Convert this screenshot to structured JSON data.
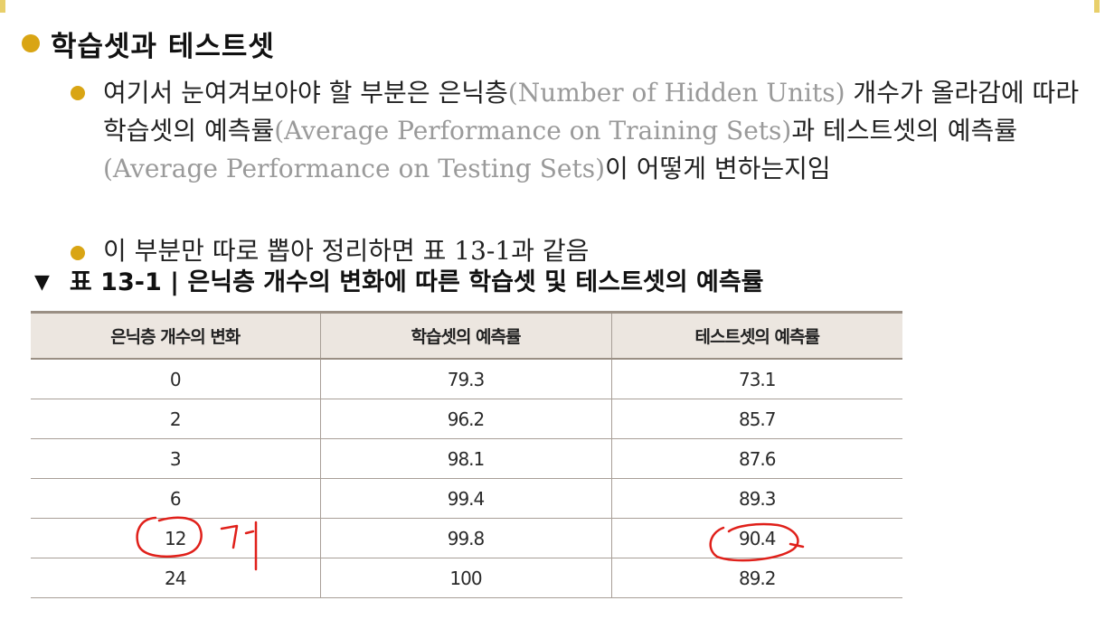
{
  "heading": "학습셋과 테스트셋",
  "paragraph1": {
    "part1": "여기서 눈여겨보아야 할 부분은 은닉층",
    "eng1": "(Number of Hidden Units)",
    "part2": " 개수가 올라감에 따라 학습셋의 예측률",
    "eng2": "(Average Performance on Training Sets)",
    "part3": "과 테스트셋의 예측률",
    "eng3": "(Average Performance on Testing Sets)",
    "part4": "이 어떻게 변하는지임"
  },
  "paragraph2": "이 부분만 따로 뽑아 정리하면 표 13-1과 같음",
  "table": {
    "caption": "표 13-1 | 은닉층 개수의 변화에 따른 학습셋 및 테스트셋의 예측률",
    "headers": [
      "은닉층 개수의 변화",
      "학습셋의 예측률",
      "테스트셋의 예측률"
    ],
    "rows": [
      [
        "0",
        "79.3",
        "73.1"
      ],
      [
        "2",
        "96.2",
        "85.7"
      ],
      [
        "3",
        "98.1",
        "87.6"
      ],
      [
        "6",
        "99.4",
        "89.3"
      ],
      [
        "12",
        "99.8",
        "90.4"
      ],
      [
        "24",
        "100",
        "89.2"
      ]
    ]
  },
  "annotations": {
    "ink_color": "#e0201a",
    "handwritten_note": "개",
    "circled_cells": [
      "12",
      "90.4"
    ]
  },
  "colors": {
    "bullet": "#d9a514",
    "table_header_bg": "#ece6e0",
    "english_text": "#9a9a9a"
  }
}
